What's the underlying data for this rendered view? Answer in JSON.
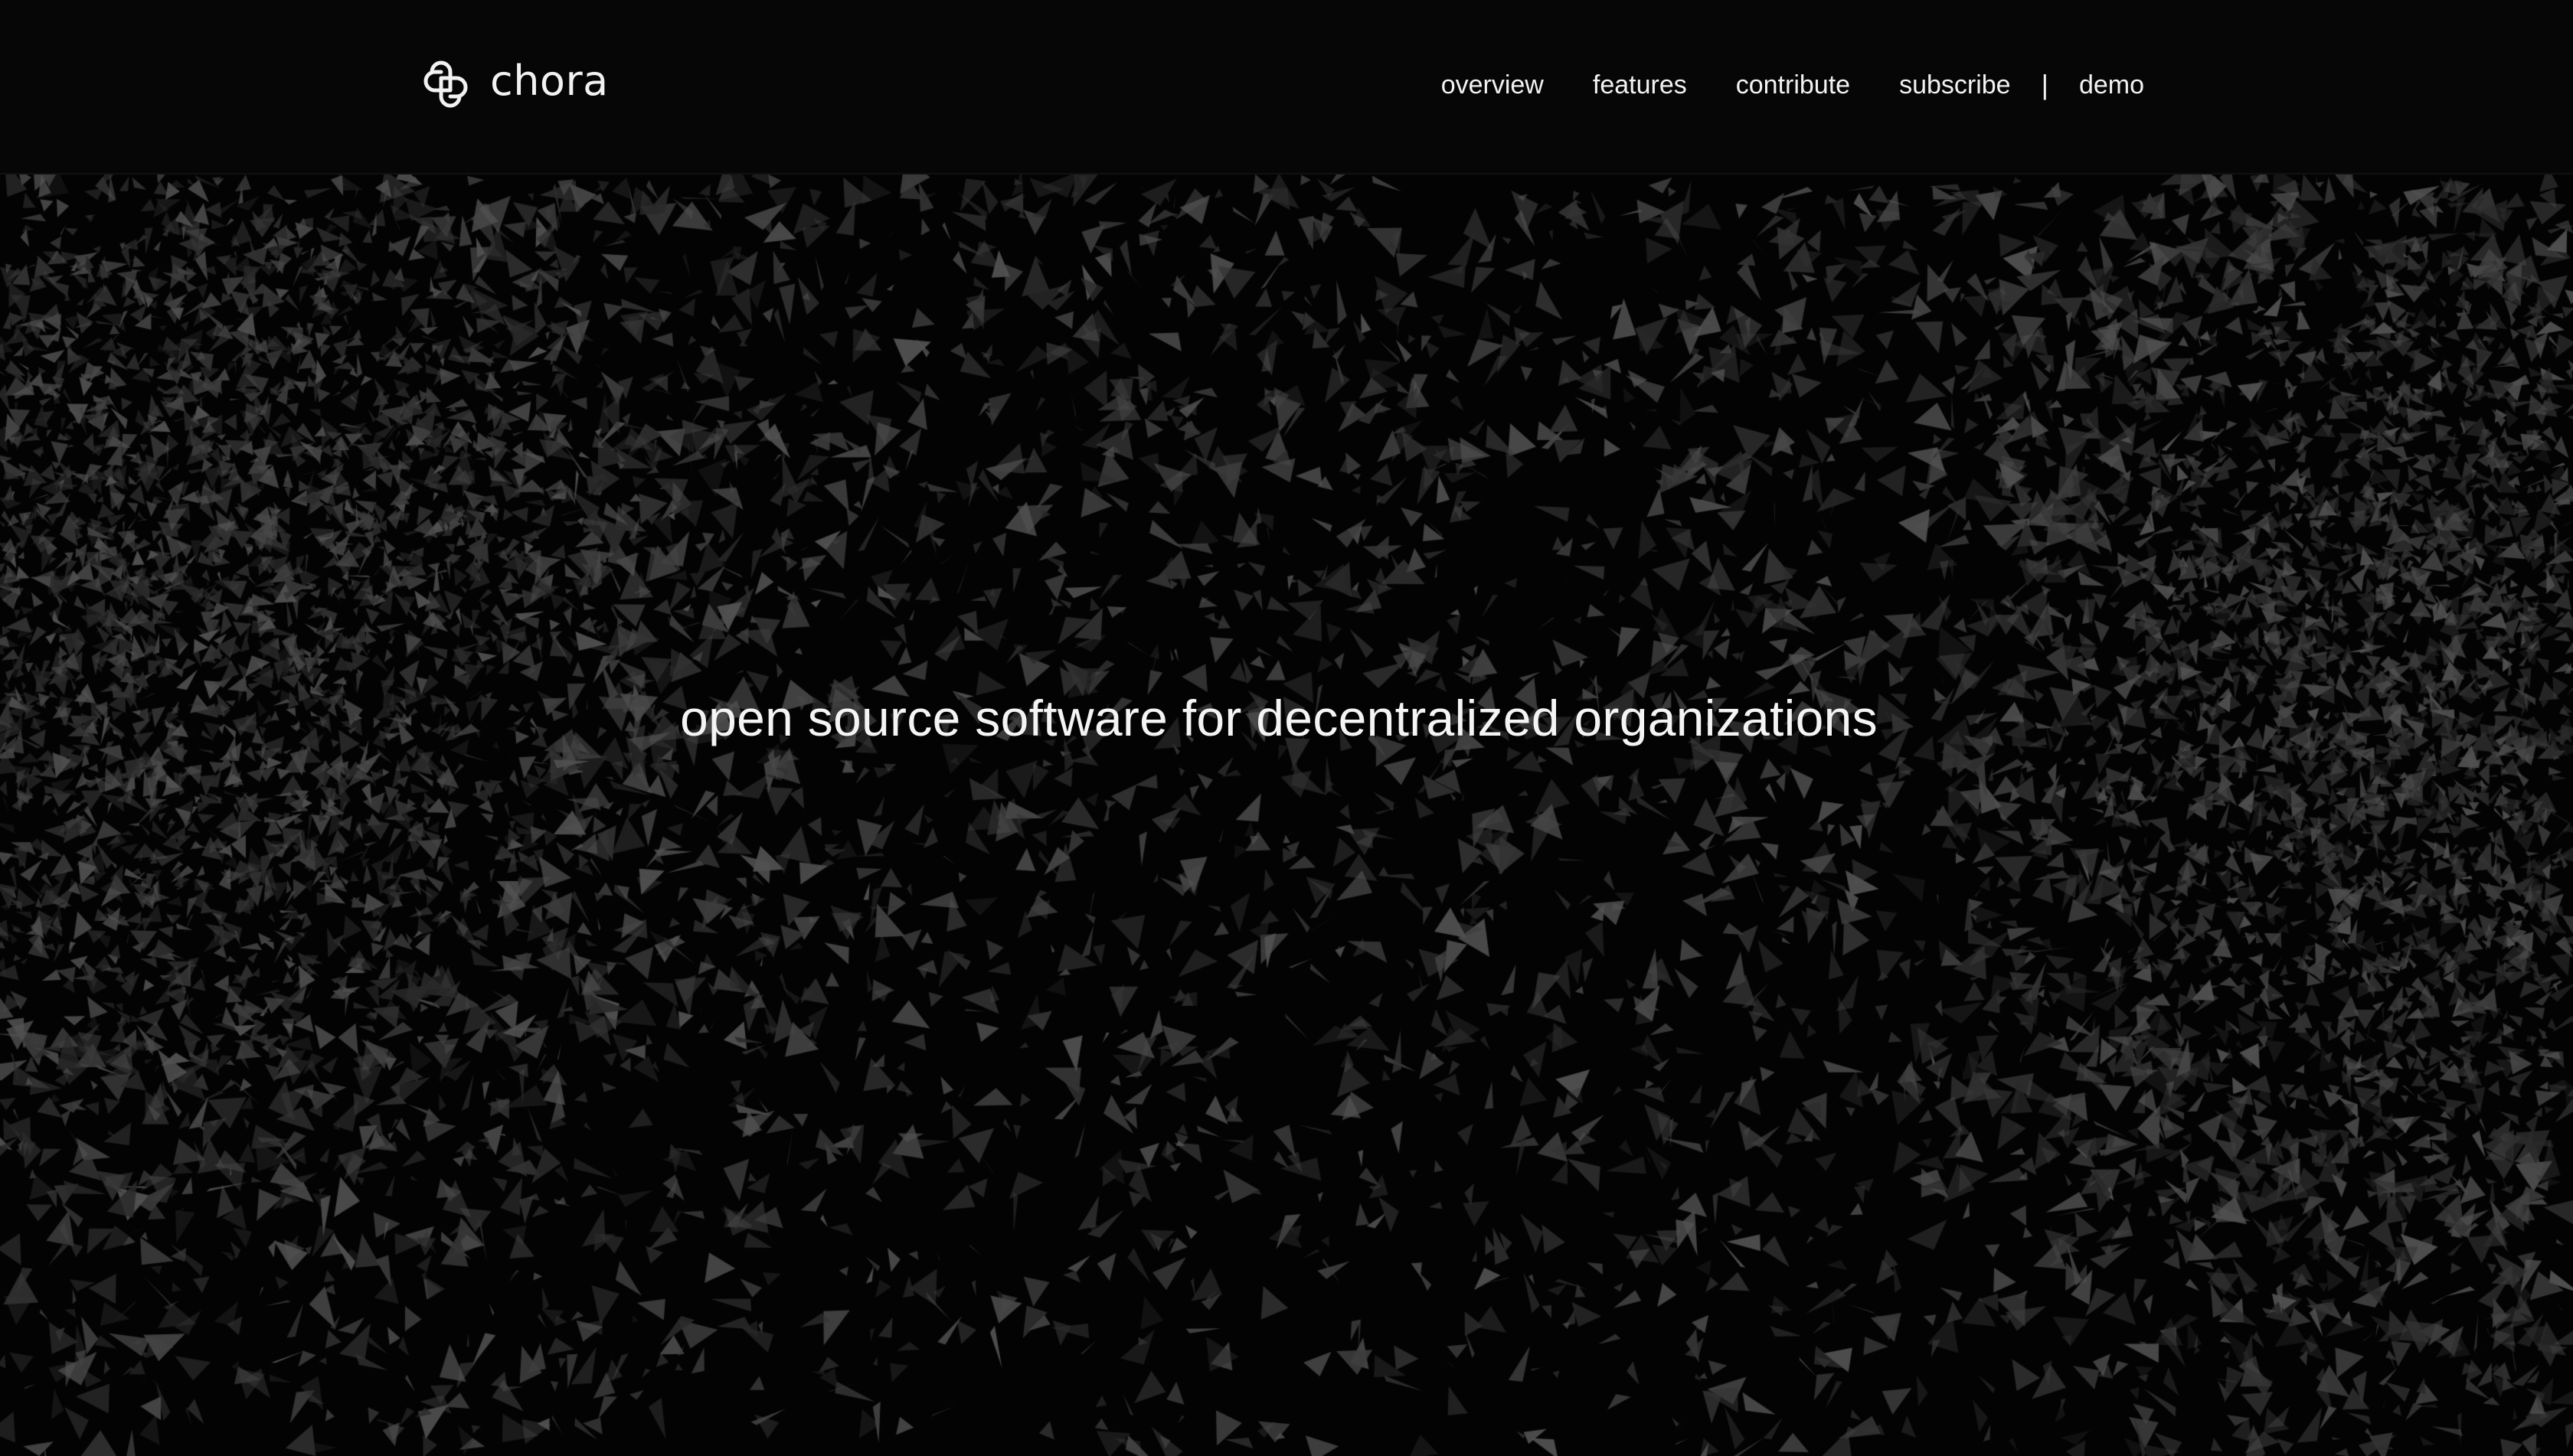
{
  "brand": {
    "name": "chora",
    "logo_icon": "interlocked-loops-logo"
  },
  "nav": {
    "items": [
      {
        "label": "overview"
      },
      {
        "label": "features"
      },
      {
        "label": "contribute"
      },
      {
        "label": "subscribe"
      }
    ],
    "separator": "|",
    "demo_label": "demo"
  },
  "hero": {
    "tagline": "open source software for decentralized organizations"
  },
  "theme": {
    "background": "#030303",
    "header_background": "#060606",
    "text": "#f2f2f2",
    "shard_colors": [
      "#2a2a2a",
      "#333333",
      "#3d3d3d",
      "#474747",
      "#525252"
    ]
  }
}
